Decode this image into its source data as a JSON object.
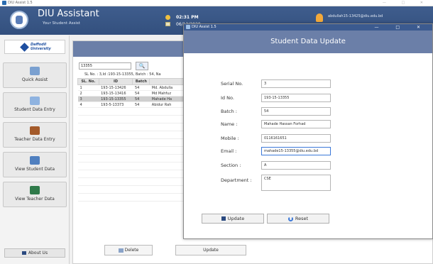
{
  "window": {
    "title": "DIU Assist 1.5"
  },
  "header": {
    "app_name": "DIU Assistant",
    "subtitle": "Your Student Assist",
    "time": "02:31 PM",
    "date": "06/12/2020",
    "user_email": "abdullah15-13425@diu.edu.bd"
  },
  "sidebar": {
    "brand": "Daffodil University",
    "items": [
      {
        "label": "Quick Assist",
        "icon": "chart-icon",
        "color": "#7aa0d0"
      },
      {
        "label": "Student Data Entry",
        "icon": "student-add-icon",
        "color": "#8fb3e0"
      },
      {
        "label": "Teacher Data Entry",
        "icon": "teacher-icon",
        "color": "#a35a2a"
      },
      {
        "label": "View Student Data",
        "icon": "student-view-icon",
        "color": "#4f7fbf"
      },
      {
        "label": "View Teacher Data",
        "icon": "board-icon",
        "color": "#2f7a4a"
      }
    ],
    "about_label": "About Us"
  },
  "main": {
    "search_value": "13355",
    "info_line": "SL No. : 3,Id :193-15-13355, Batch : 54, Na",
    "columns": [
      "SL. No.",
      "ID",
      "Batch",
      ""
    ],
    "rows": [
      {
        "sl": "1",
        "id": "193-15-13426",
        "batch": "54",
        "name": "Md. Abdulla",
        "selected": false
      },
      {
        "sl": "2",
        "id": "193-15-13416",
        "batch": "54",
        "name": "Md Mahfuz",
        "selected": false
      },
      {
        "sl": "3",
        "id": "193-15-13355",
        "batch": "54",
        "name": "Mahade Ha",
        "selected": true
      },
      {
        "sl": "4",
        "id": "193-5-13373",
        "batch": "54",
        "name": "Abidur Rah",
        "selected": false
      }
    ],
    "delete_label": "Delete",
    "update_label": "Update"
  },
  "dialog": {
    "window_title": "DIU Assist 1.5",
    "heading": "Student Data Update",
    "fields": {
      "serial": {
        "label": "Serial No.",
        "value": "3"
      },
      "id": {
        "label": "Id No.",
        "value": "193-15-13355"
      },
      "batch": {
        "label": "Batch :",
        "value": "54"
      },
      "name": {
        "label": "Name :",
        "value": "Mahade Hassan Forhad"
      },
      "mobile": {
        "label": "Mobile :",
        "value": "0116161651"
      },
      "email": {
        "label": "Email :",
        "value": "mahade15-13355@diu.edu.bd"
      },
      "section": {
        "label": "Section :",
        "value": "A"
      },
      "department": {
        "label": "Department :",
        "value": "CSE"
      }
    },
    "update_label": "Update",
    "reset_label": "Reset"
  }
}
